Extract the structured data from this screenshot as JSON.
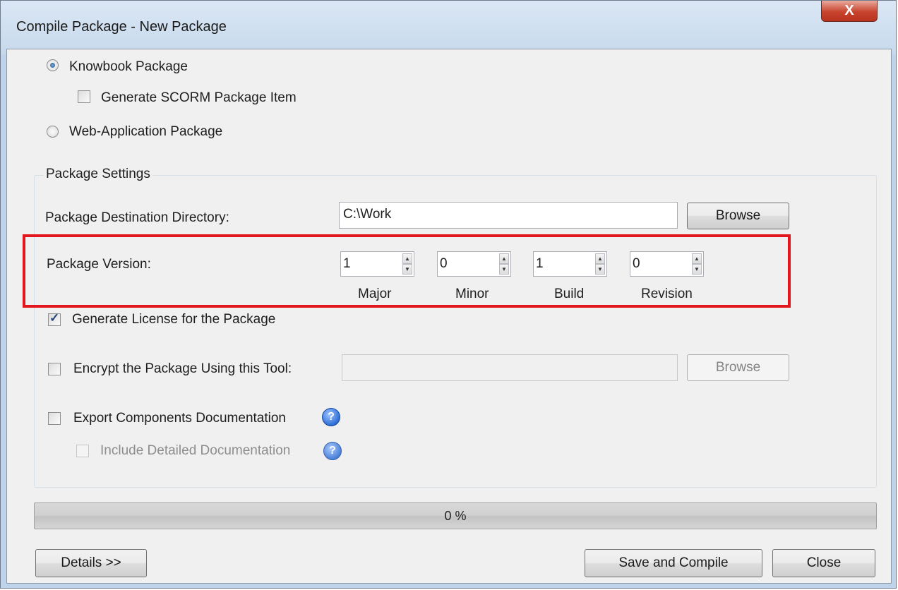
{
  "window": {
    "title": "Compile Package - New Package",
    "close_glyph": "X"
  },
  "package_type": {
    "knowbook_label": "Knowbook Package",
    "knowbook_selected": true,
    "scorm_label": "Generate SCORM Package Item",
    "scorm_checked": false,
    "webapp_label": "Web-Application Package",
    "webapp_selected": false
  },
  "settings": {
    "group_title": "Package Settings",
    "destination_label": "Package Destination Directory:",
    "destination_value": "C:\\Work",
    "browse_label": "Browse",
    "version_label": "Package Version:",
    "version": [
      {
        "value": "1",
        "caption": "Major"
      },
      {
        "value": "0",
        "caption": "Minor"
      },
      {
        "value": "1",
        "caption": "Build"
      },
      {
        "value": "0",
        "caption": "Revision"
      }
    ],
    "license_label": "Generate License for the Package",
    "license_checked": true,
    "encrypt_label": "Encrypt the Package Using this Tool:",
    "encrypt_value": "",
    "encrypt_browse_label": "Browse",
    "export_docs_label": "Export Components Documentation",
    "detailed_docs_label": "Include Detailed Documentation"
  },
  "progress": {
    "text": "0 %",
    "fraction": 0
  },
  "footer": {
    "details_label": "Details >>",
    "save_compile_label": "Save and Compile",
    "close_label": "Close"
  },
  "colors": {
    "highlight": "#e3161d",
    "client_bg": "#f0f0f0",
    "title_bar": "#c6d9ec"
  }
}
